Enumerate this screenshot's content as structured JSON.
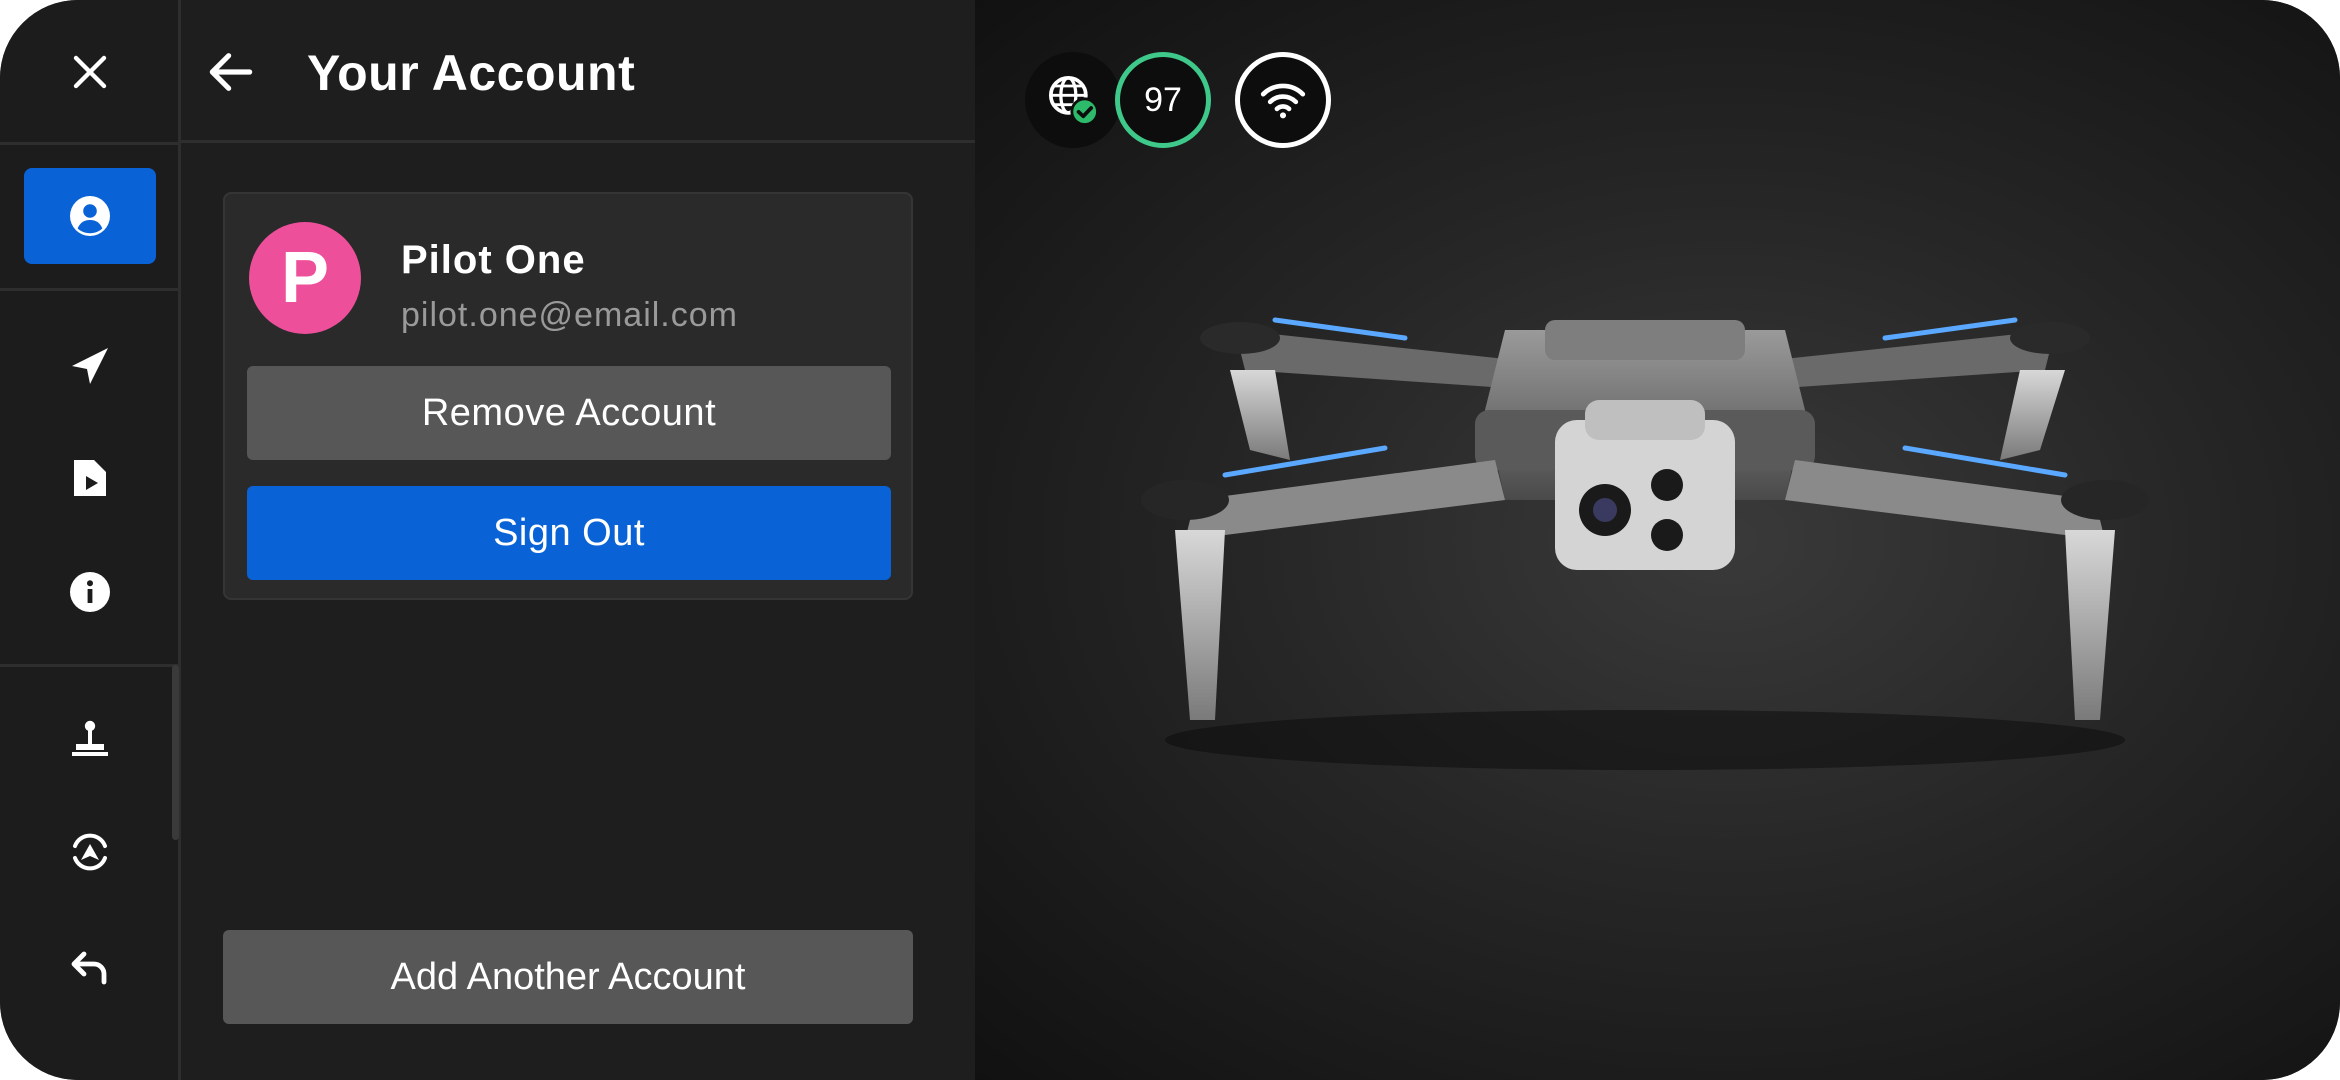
{
  "rail": {
    "items": [
      {
        "name": "close",
        "icon": "close-icon",
        "active": false
      },
      {
        "name": "account",
        "icon": "account-icon",
        "active": true
      },
      {
        "name": "navigation",
        "icon": "navigation-arrow-icon",
        "active": false
      },
      {
        "name": "media",
        "icon": "media-file-icon",
        "active": false
      },
      {
        "name": "info",
        "icon": "info-icon",
        "active": false
      },
      {
        "name": "controller",
        "icon": "joystick-icon",
        "active": false
      },
      {
        "name": "recenter",
        "icon": "recenter-icon",
        "active": false
      },
      {
        "name": "return",
        "icon": "return-icon",
        "active": false
      }
    ],
    "accent": "#0a63d6"
  },
  "panel": {
    "title": "Your Account"
  },
  "account": {
    "initial": "P",
    "name": "Pilot One",
    "email": "pilot.one@email.com",
    "avatar_color": "#ee4f9a",
    "remove_label": "Remove Account",
    "signout_label": "Sign Out"
  },
  "footer": {
    "add_label": "Add Another Account"
  },
  "status": {
    "gps_icon": "globe-check-icon",
    "battery_percent": "97",
    "battery_color": "#3ec98b",
    "wifi_icon": "wifi-icon"
  }
}
